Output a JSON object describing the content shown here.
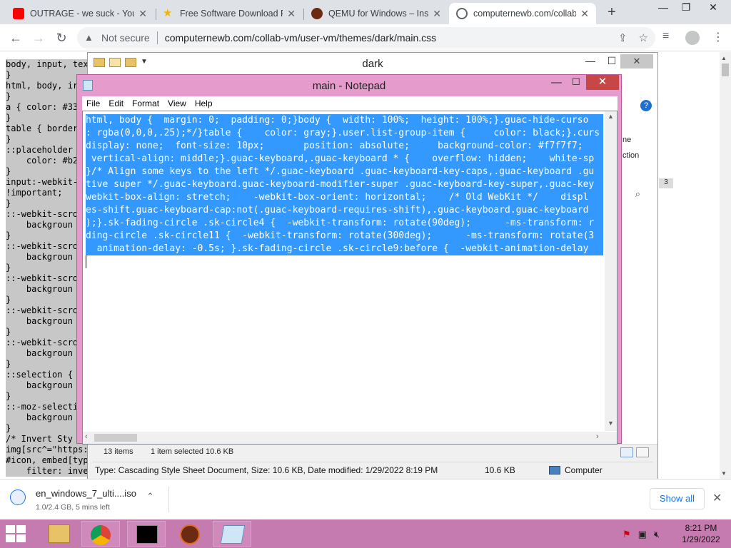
{
  "browser": {
    "tabs": [
      {
        "title": "OUTRAGE - we suck - YouT",
        "favicon": "youtube-icon",
        "active": false
      },
      {
        "title": "Free Software Download P",
        "favicon": "star-icon",
        "active": false
      },
      {
        "title": "QEMU for Windows – Insta",
        "favicon": "qemu-icon",
        "active": false
      },
      {
        "title": "computernewb.com/collab",
        "favicon": "page-icon",
        "active": true
      }
    ],
    "new_tab": "+",
    "window_controls": {
      "minimize": "—",
      "restore": "❐",
      "close": "✕"
    },
    "security_label": "Not secure",
    "url": "computernewb.com/collab-vm/user-vm/themes/dark/main.css"
  },
  "page": {
    "lines": [
      "body, input, tex",
      "}",
      "html, body, ir",
      "}",
      "a { color: #33",
      "}",
      "table { border",
      "}",
      "::placeholder",
      "    color: #b2",
      "}",
      "input:-webkit-",
      "!important;",
      "}",
      "::-webkit-scro",
      "    backgroun",
      "}",
      "::-webkit-scro",
      "    backgroun",
      "}",
      "::-webkit-scro",
      "    backgroun",
      "}",
      "::-webkit-scro",
      "    backgroun",
      "}",
      "::-webkit-scro",
      "    backgroun",
      "}",
      "::selection {",
      "    backgroun",
      "}",
      "::-moz-selecti",
      "    backgroun",
      "}",
      "/* Invert Sty",
      "img[src^=\"https:",
      "#icon, embed[typ",
      "    filter: inve"
    ]
  },
  "explorer": {
    "title": "dark",
    "items_count": "13 items",
    "selected": "1 item selected  10.6 KB",
    "details_type": "Type: Cascading Style Sheet Document, Size: 10.6 KB, Date modified: 1/29/2022 8:19 PM",
    "details_size": "10.6 KB",
    "details_location": "Computer",
    "right_fragment_1": "ne",
    "right_fragment_2": "ction",
    "badge": "3"
  },
  "notepad": {
    "title": "main - Notepad",
    "menu": [
      "File",
      "Edit",
      "Format",
      "View",
      "Help"
    ],
    "lines": [
      "html, body {  margin: 0;  padding: 0;}body {  width: 100%;  height: 100%;}.guac-hide-curso",
      ": rgba(0,0,0,.25);*/}table {    color: gray;}.user.list-group-item {     color: black;}.curs",
      "display: none;  font-size: 10px;       position: absolute;     background-color: #f7f7f7;",
      " vertical-align: middle;}.guac-keyboard,.guac-keyboard * {    overflow: hidden;    white-sp",
      "}/* Align some keys to the left */.guac-keyboard .guac-keyboard-key-caps,.guac-keyboard .gu",
      "tive super */.guac-keyboard.guac-keyboard-modifier-super .guac-keyboard-key-super,.guac-key",
      "webkit-box-align: stretch;    -webkit-box-orient: horizontal;    /* Old WebKit */    displ",
      "es-shift.guac-keyboard-cap:not(.guac-keyboard-requires-shift),.guac-keyboard.guac-keyboard",
      ");}.sk-fading-circle .sk-circle4 {  -webkit-transform: rotate(90deg);      -ms-transform: r",
      "ding-circle .sk-circle11 {  -webkit-transform: rotate(300deg);      -ms-transform: rotate(3",
      "  animation-delay: -0.5s; }.sk-fading-circle .sk-circle9:before {  -webkit-animation-delay"
    ]
  },
  "downloads": {
    "file_name": "en_windows_7_ulti....iso",
    "progress_text": "1.0/2.4 GB, 5 mins left",
    "show_all": "Show all"
  },
  "taskbar": {
    "time": "8:21 PM",
    "date": "1/29/2022",
    "apps": [
      "explorer-icon",
      "chrome-icon",
      "cmd-icon",
      "qemu-icon",
      "notepad-icon"
    ]
  },
  "colors": {
    "selection": "#3399ff",
    "notepad_frame": "#e59ccd",
    "taskbar": "#c67bb0",
    "close_red": "#c74646"
  }
}
